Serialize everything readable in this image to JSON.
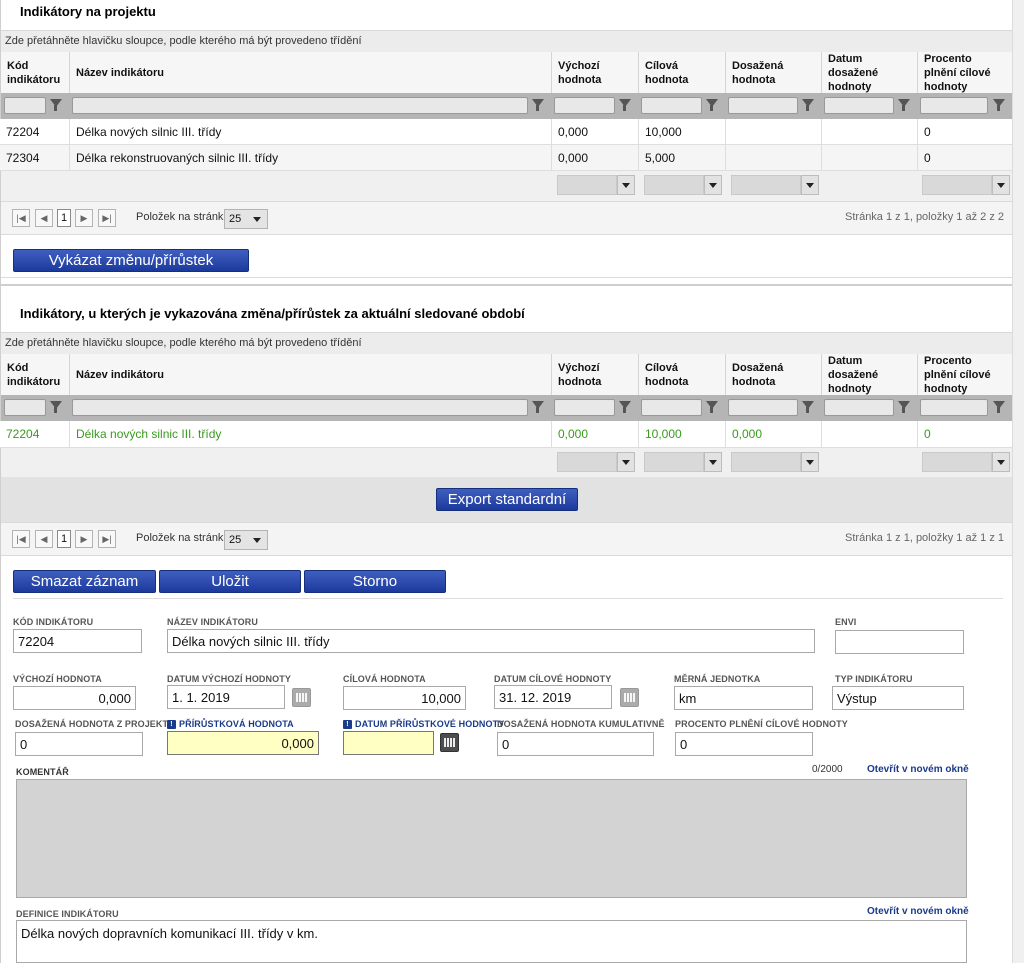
{
  "section1": {
    "title": "Indikátory na projektu",
    "group_hint": "Zde přetáhněte hlavičku sloupce, podle kterého má být provedeno třídění",
    "columns": [
      "Kód indikátoru",
      "Název indikátoru",
      "Výchozí hodnota",
      "Cílová hodnota",
      "Dosažená hodnota",
      "Datum dosažené hodnoty",
      "Procento plnění cílové hodnoty"
    ],
    "rows": [
      {
        "kod": "72204",
        "nazev": "Délka nových silnic III. třídy",
        "vychozi": "0,000",
        "cilova": "10,000",
        "dosazena": "",
        "datum": "",
        "procento": "0"
      },
      {
        "kod": "72304",
        "nazev": "Délka rekonstruovaných silnic III. třídy",
        "vychozi": "0,000",
        "cilova": "5,000",
        "dosazena": "",
        "datum": "",
        "procento": "0"
      }
    ],
    "pager": {
      "page": "1",
      "per_page_label": "Položek na stránku",
      "per_page": "25",
      "info": "Stránka 1 z 1, položky 1 až 2 z 2"
    },
    "button": "Vykázat změnu/přírůstek"
  },
  "section2": {
    "title": "Indikátory, u kterých je vykazována změna/přírůstek za aktuální sledované období",
    "group_hint": "Zde přetáhněte hlavičku sloupce, podle kterého má být provedeno třídění",
    "columns": [
      "Kód indikátoru",
      "Název indikátoru",
      "Výchozí hodnota",
      "Cílová hodnota",
      "Dosažená hodnota",
      "Datum dosažené hodnoty",
      "Procento plnění cílové hodnoty"
    ],
    "rows": [
      {
        "kod": "72204",
        "nazev": "Délka nových silnic III. třídy",
        "vychozi": "0,000",
        "cilova": "10,000",
        "dosazena": "0,000",
        "datum": "",
        "procento": "0"
      }
    ],
    "export_button": "Export standardní",
    "pager": {
      "page": "1",
      "per_page_label": "Položek na stránku",
      "per_page": "25",
      "info": "Stránka 1 z 1, položky 1 až 1 z 1"
    }
  },
  "actions": {
    "delete": "Smazat záznam",
    "save": "Uložit",
    "cancel": "Storno"
  },
  "form": {
    "kod_label": "Kód indikátoru",
    "kod": "72204",
    "nazev_label": "Název indikátoru",
    "nazev": "Délka nových silnic III. třídy",
    "envi_label": "ENVI",
    "envi": "",
    "vychozi_label": "Výchozí hodnota",
    "vychozi": "0,000",
    "datum_vychozi_label": "Datum výchozí hodnoty",
    "datum_vychozi": "1. 1. 2019",
    "cilova_label": "Cílová hodnota",
    "cilova": "10,000",
    "datum_cilove_label": "Datum cílové hodnoty",
    "datum_cilove": "31. 12. 2019",
    "jednotka_label": "Měrná jednotka",
    "jednotka": "km",
    "typ_label": "Typ indikátoru",
    "typ": "Výstup",
    "dosazena_label": "Dosažená hodnota z projektu",
    "dosazena": "0",
    "prirustkova_label": "Přírůstková hodnota",
    "prirustkova": "0,000",
    "datum_prirustkove_label": "Datum přírůstkové hodnoty",
    "datum_prirustkove": "",
    "kumulativne_label": "Dosažená hodnota kumulativně",
    "kumulativne": "0",
    "procento_label": "Procento plnění cílové hodnoty",
    "procento": "0",
    "komentar_label": "Komentář",
    "komentar_count": "0/2000",
    "open_new_window": "Otevřít v novém okně",
    "komentar": "",
    "definice_label": "Definice indikátoru",
    "definice_open": "Otevřít v novém okně",
    "definice": "Délka nových dopravních komunikací III. třídy v km."
  },
  "colors": {
    "button": "#1c3a9c",
    "green_text": "#3b9a1f",
    "required_field": "#ffffc4"
  }
}
